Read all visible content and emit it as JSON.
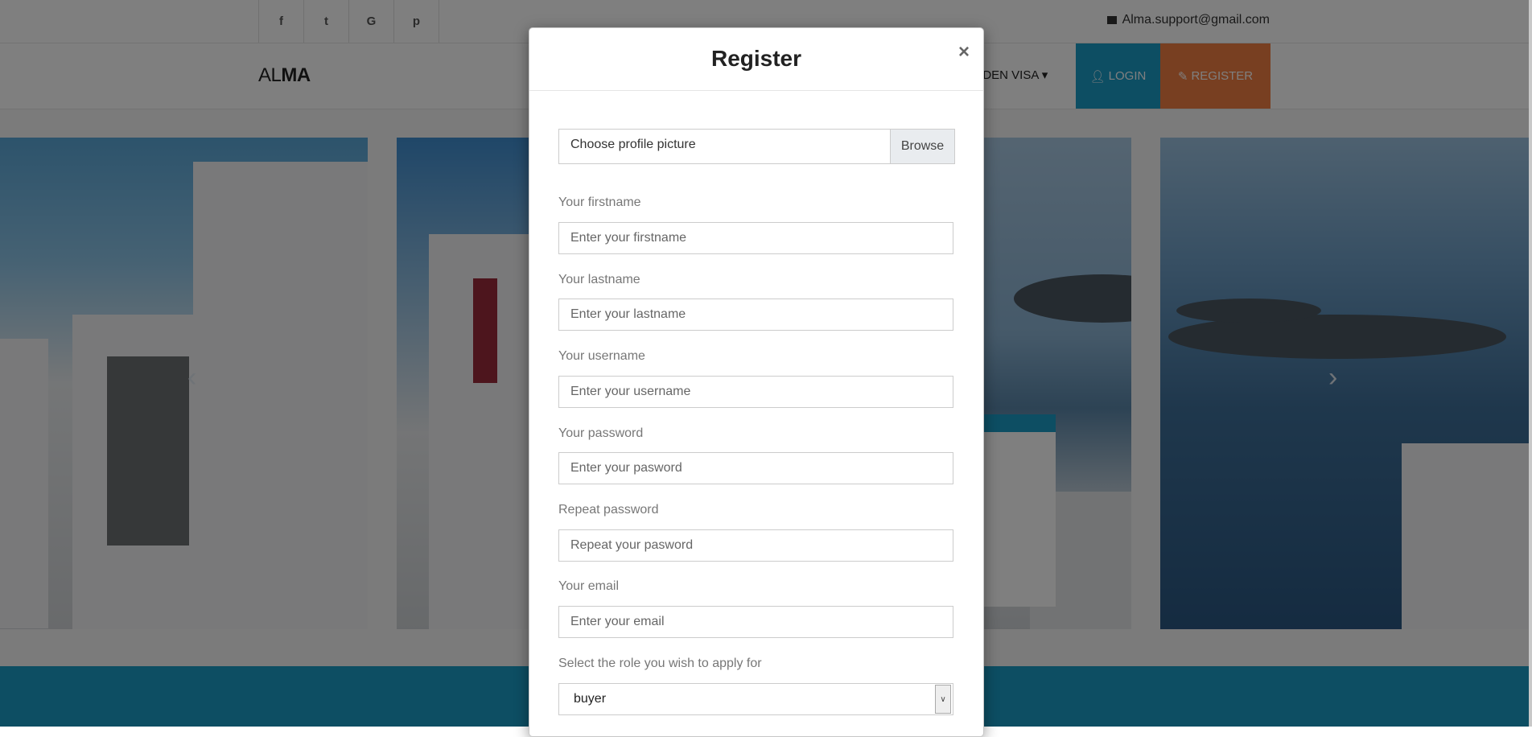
{
  "header": {
    "social": [
      {
        "name": "facebook",
        "glyph": "f"
      },
      {
        "name": "twitter",
        "glyph": "t"
      },
      {
        "name": "google",
        "glyph": "G"
      },
      {
        "name": "pinterest",
        "glyph": "p"
      }
    ],
    "contact_email": "Alma.support@gmail.com",
    "logo_light": "AL",
    "logo_bold": "MA",
    "menu_golden_visa": "LDEN VISA ▾",
    "login_label": "LOGIN",
    "register_label": "REGISTER"
  },
  "colors": {
    "accent_blue": "#1b9cc6",
    "accent_orange": "#f07f42"
  },
  "modal": {
    "title": "Register",
    "close": "×",
    "file_label": "Choose profile picture",
    "browse_label": "Browse",
    "fields": [
      {
        "label": "Your firstname",
        "placeholder": "Enter your firstname"
      },
      {
        "label": "Your lastname",
        "placeholder": "Enter your lastname"
      },
      {
        "label": "Your username",
        "placeholder": "Enter your username"
      },
      {
        "label": "Your password",
        "placeholder": "Enter your pasword"
      },
      {
        "label": "Repeat password",
        "placeholder": "Repeat your pasword"
      },
      {
        "label": "Your email",
        "placeholder": "Enter your email"
      }
    ],
    "role_label": "Select the role you wish to apply for",
    "role_value": "buyer"
  }
}
